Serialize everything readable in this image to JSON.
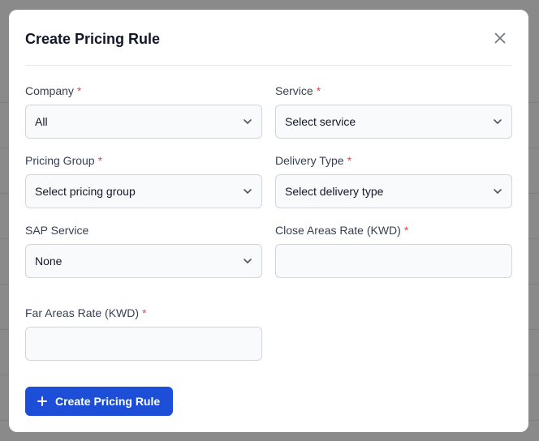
{
  "modal": {
    "title": "Create Pricing Rule",
    "submit_label": "Create Pricing Rule"
  },
  "fields": {
    "company": {
      "label": "Company",
      "required_mark": "*",
      "value": "All"
    },
    "service": {
      "label": "Service",
      "required_mark": "*",
      "value": "Select service"
    },
    "pricing_group": {
      "label": "Pricing Group",
      "required_mark": "*",
      "value": "Select pricing group"
    },
    "delivery_type": {
      "label": "Delivery Type",
      "required_mark": "*",
      "value": "Select delivery type"
    },
    "sap_service": {
      "label": "SAP Service",
      "value": "None"
    },
    "close_areas_rate": {
      "label": "Close Areas Rate (KWD)",
      "required_mark": "*",
      "value": ""
    },
    "far_areas_rate": {
      "label": "Far Areas Rate (KWD)",
      "required_mark": "*",
      "value": ""
    }
  },
  "icons": {
    "close": "close-icon",
    "chevron": "chevron-down-icon",
    "plus": "plus-icon"
  },
  "colors": {
    "primary_button": "#1d4ed8",
    "required_asterisk": "#ef4444",
    "overlay": "#8a8a8a"
  }
}
